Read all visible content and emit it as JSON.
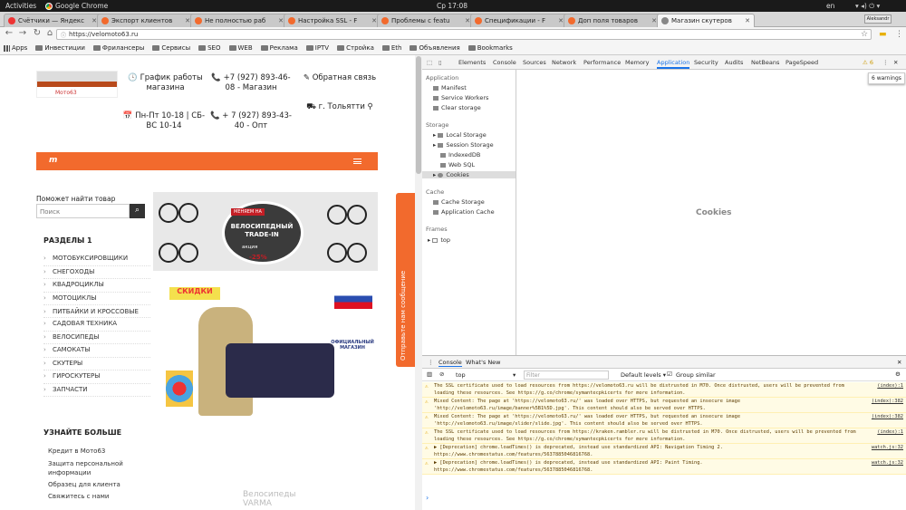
{
  "os": {
    "activities": "Activities",
    "app_name": "Google Chrome",
    "clock": "Ср 17:08",
    "lang": "en",
    "tray": "▾ ◂) ⏻ ▾"
  },
  "tabs": [
    {
      "label": "Счётчики — Яндекс",
      "color": "#e33"
    },
    {
      "label": "Экспорт клиентов",
      "color": "#f26a2d"
    },
    {
      "label": "Не полностью раб",
      "color": "#f26a2d"
    },
    {
      "label": "Настройка SSL - F",
      "color": "#f26a2d"
    },
    {
      "label": "Проблемы с featu",
      "color": "#f26a2d"
    },
    {
      "label": "Спецификации - F",
      "color": "#f26a2d"
    },
    {
      "label": "Доп поля товаров",
      "color": "#f26a2d"
    },
    {
      "label": "Магазин скутеров",
      "color": "#888"
    }
  ],
  "corner_label": "Aleksandr",
  "url": "https://velomoto63.ru",
  "bookmarks": [
    "Apps",
    "Инвестиции",
    "Фрилансеры",
    "Сервисы",
    "SEO",
    "WEB",
    "Реклама",
    "IPTV",
    "Стройка",
    "Eth",
    "Объявления",
    "Bookmarks"
  ],
  "site": {
    "logo": "Мото63",
    "h1": "🕓 График работы магазина",
    "h2": "📞 +7 (927) 893-46-08 - Магазин",
    "h3": "✎ Обратная связь",
    "h4": "📅 Пн-Пт 10-18 | СБ-ВС 10-14",
    "h5": "📞 + 7 (927) 893-43-40 - Опт",
    "h6": "⛟ г. Тольятти ⚲",
    "menu_logo": "m",
    "search_title": "Поможет найти товар",
    "search_placeholder": "Поиск",
    "sections_title": "РАЗДЕЛЫ 1",
    "categories": [
      "МОТОБУКСИРОВЩИКИ",
      "СНЕГОХОДЫ",
      "КВАДРОЦИКЛЫ",
      "МОТОЦИКЛЫ",
      "ПИТБАЙКИ И КРОССОВЫЕ",
      "САДОВАЯ ТЕХНИКА",
      "ВЕЛОСИПЕДЫ",
      "САМОКАТЫ",
      "СКУТЕРЫ",
      "ГИРОСКУТЕРЫ",
      "ЗАПЧАСТИ"
    ],
    "learn_title": "УЗНАЙТЕ БОЛЬШЕ",
    "links": [
      "Кредит в Мото63",
      "Защита персональной информации",
      "Образец для клиента",
      "Свяжитесь с нами"
    ],
    "banner1": {
      "badge": "МЕНЯЕМ НА",
      "title": "ВЕЛОСИПЕДНЫЙ TRADE-IN",
      "promo": "акция",
      "pct": "-25%"
    },
    "banner2": {
      "sticker": "СКИДКИ",
      "official": "ОФИЦИАЛЬНЫЙ МАГАЗИН"
    },
    "lightbox_text": "Велосипеды VARMA",
    "side_button": "Отправьте нам сообщение"
  },
  "devtools": {
    "tabs": [
      "Elements",
      "Console",
      "Sources",
      "Network",
      "Performance",
      "Memory",
      "Application",
      "Security",
      "Audits",
      "NetBeans",
      "PageSpeed"
    ],
    "warn_count": "⚠ 6",
    "tooltip": "6 warnings",
    "sections": {
      "application": "Application",
      "manifest": "Manifest",
      "sw": "Service Workers",
      "clear": "Clear storage",
      "storage": "Storage",
      "local": "Local Storage",
      "session": "Session Storage",
      "idb": "IndexedDB",
      "websql": "Web SQL",
      "cookies": "Cookies",
      "cache": "Cache",
      "cachestorage": "Cache Storage",
      "appcache": "Application Cache",
      "frames": "Frames",
      "top": "top"
    },
    "main_label": "Cookies",
    "drawer_tabs": [
      "Console",
      "What's New"
    ],
    "context": "top",
    "filter": "Filter",
    "levels": "Default levels ▾",
    "group": "Group similar",
    "messages": [
      {
        "text": "The SSL certificate used to load resources from https://velomoto63.ru will be distrusted in M70. Once distrusted, users will be prevented from loading these resources. See https://g.co/chrome/symantecpkicerts for more information.",
        "src": "(index):1"
      },
      {
        "text": "Mixed Content: The page at 'https://velomoto63.ru/' was loaded over HTTPS, but requested an insecure image 'http://velomoto63.ru/image/banner%5B1%5D.jpg'. This content should also be served over HTTPS.",
        "src": "(index):382"
      },
      {
        "text": "Mixed Content: The page at 'https://velomoto63.ru/' was loaded over HTTPS, but requested an insecure image 'http://velomoto63.ru/image/slider/slide.jpg'. This content should also be served over HTTPS.",
        "src": "(index):382"
      },
      {
        "text": "The SSL certificate used to load resources from https://kraken.rambler.ru will be distrusted in M70. Once distrusted, users will be prevented from loading these resources. See https://g.co/chrome/symantecpkicerts for more information.",
        "src": "(index):1"
      },
      {
        "text": "▶ [Deprecation] chrome.loadTimes() is deprecated, instead use standardized API: Navigation Timing 2. https://www.chromestatus.com/features/5637885046816768.",
        "src": "watch.js:32"
      },
      {
        "text": "▶ [Deprecation] chrome.loadTimes() is deprecated, instead use standardized API: Paint Timing. https://www.chromestatus.com/features/5637885046816768.",
        "src": "watch.js:32"
      }
    ]
  }
}
